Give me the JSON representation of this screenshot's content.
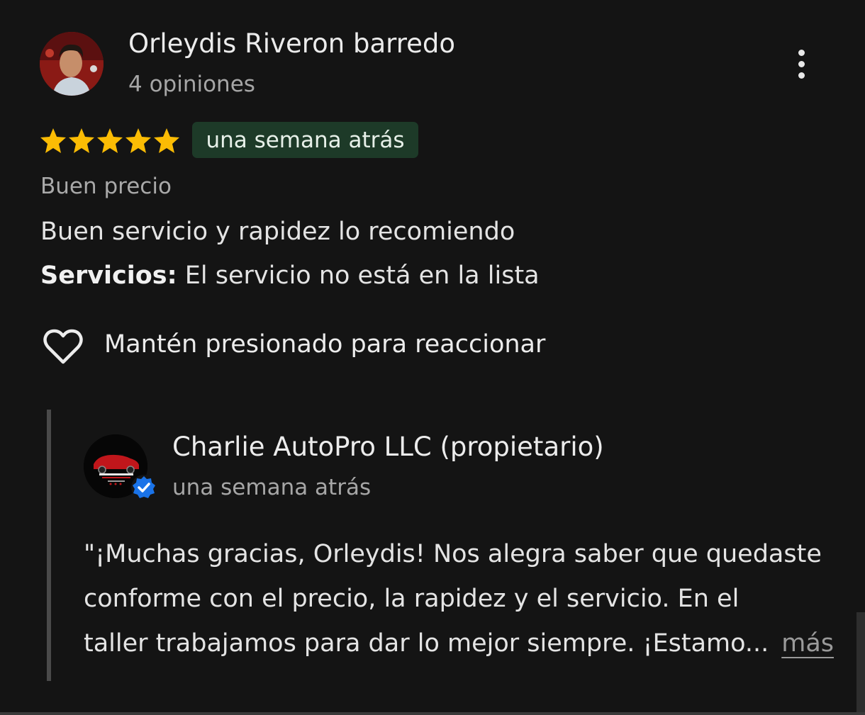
{
  "review": {
    "reviewer_name": "Orleydis Riveron barredo",
    "reviewer_stats": "4 opiniones",
    "rating": 5,
    "rating_max": 5,
    "time_ago": "una semana atrás",
    "tag": "Buen precio",
    "text": "Buen servicio y rapidez lo recomiendo",
    "services_label": "Servicios:",
    "services_value": " El servicio no está en la lista",
    "react_label": "Mantén presionado para reaccionar"
  },
  "owner_reply": {
    "name": "Charlie AutoPro LLC (propietario)",
    "time_ago": "una semana atrás",
    "lines": [
      "\"¡Muchas gracias, Orleydis! Nos alegra saber que quedaste",
      "conforme con el precio, la rapidez y el servicio. En el",
      "taller trabajamos para dar lo mejor siempre. ¡Estamo..."
    ],
    "more_label": "más"
  },
  "colors": {
    "background": "#141414",
    "star": "#fbbc04",
    "badge_bg": "#1d3a28",
    "verified": "#1a73e8"
  },
  "icons": {
    "menu": "more-vert-icon",
    "star": "star-icon",
    "react": "heart-outline-icon",
    "verified": "verified-badge-icon"
  }
}
